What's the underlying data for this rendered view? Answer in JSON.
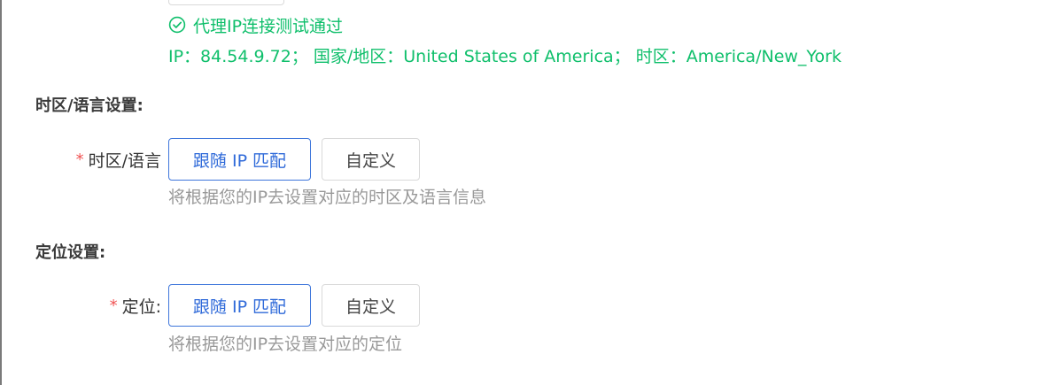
{
  "proxy_test": {
    "success_message": "代理IP连接测试通过",
    "ip_info": "IP：84.54.9.72； 国家/地区：United States of America； 时区：America/New_York"
  },
  "timezone_section": {
    "title": "时区/语言设置:",
    "field_label": "时区/语言",
    "option_follow_ip": "跟随 IP 匹配",
    "option_custom": "自定义",
    "hint": "将根据您的IP去设置对应的时区及语言信息"
  },
  "location_section": {
    "title": "定位设置:",
    "field_label": "定位:",
    "option_follow_ip": "跟随 IP 匹配",
    "option_custom": "自定义",
    "hint": "将根据您的IP去设置对应的定位"
  },
  "colors": {
    "success": "#0fbf6b",
    "primary": "#2f6ad9",
    "required": "#f05454",
    "hint": "#999999"
  },
  "icons": {
    "success": "check-circle-icon"
  }
}
